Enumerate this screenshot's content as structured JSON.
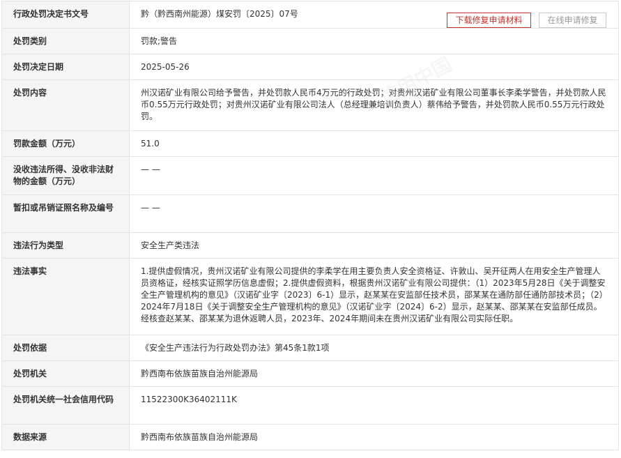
{
  "buttons": {
    "download_label": "下载修复申请材料",
    "repair_label": "在线申请修复"
  },
  "watermark_text": "信用中国",
  "rows": [
    {
      "label": "行政处罚决定书文号",
      "value": "黔（黔西南州能源）煤安罚〔2025〕07号"
    },
    {
      "label": "处罚类别",
      "value": "罚款;警告"
    },
    {
      "label": "处罚决定日期",
      "value": "2025-05-26"
    },
    {
      "label": "处罚内容",
      "value": "州汉诺矿业有限公司给予警告，并处罚款人民币4万元的行政处罚；对贵州汉诺矿业有限公司董事长李柔学警告，并处罚款人民币0.55万元行政处罚；对贵州汉诺矿业有限公司法人（总经理兼培训负责人）蔡伟给予警告，并处罚款人民币0.55万元行政处罚。"
    },
    {
      "label": "罚款金额（万元）",
      "value": "51.0"
    },
    {
      "label": "没收违法所得、没收非法财物的金额（万元）",
      "value": "— —"
    },
    {
      "label": "暂扣或吊销证照名称及编号",
      "value": "— —"
    },
    {
      "label": "违法行为类型",
      "value": "安全生产类违法"
    },
    {
      "label": "违法事实",
      "value": "1.提供虚假情况，贵州汉诺矿业有限公司提供的李柔学在用主要负责人安全资格证、许敦山、吴开征两人在用安全生产管理人员资格证，经核实证照学历信息虚假；2.提供虚假资料，根据贵州汉诺矿业有限公司提供：（1）2023年5月28日《关于调整安全生产管理机构的意见》（汉诺矿业字〔2023〕6-1）显示，赵某某在安监部任技术员，邵某某在通防部任通防部技术员；（2）2024年7月18日《关于调整安全生产管理机构的意见》（汉诺矿业字〔2024〕6-2）显示，赵某某、邵某某在安监部任成员。经核查赵某某、邵某某为退休返聘人员，2023年、2024年期间未在贵州汉诺矿业有限公司实际任职。"
    },
    {
      "label": "处罚依据",
      "value": "《安全生产违法行为行政处罚办法》第45条1款1项"
    },
    {
      "label": "处罚机关",
      "value": "黔西南布依族苗族自治州能源局"
    },
    {
      "label": "处罚机关统一社会信用代码",
      "value": "11522300K36402111K"
    },
    {
      "label": "数据来源",
      "value": "黔西南布依族苗族自治州能源局"
    }
  ]
}
